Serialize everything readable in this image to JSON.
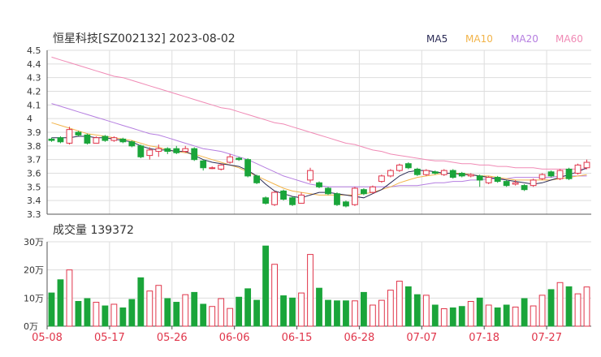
{
  "header": {
    "title": "恒星科技[SZ002132] 2023-08-02"
  },
  "legend": [
    {
      "label": "MA5",
      "color": "#2b2b55"
    },
    {
      "label": "MA10",
      "color": "#f2b44a"
    },
    {
      "label": "MA20",
      "color": "#b57ee0"
    },
    {
      "label": "MA60",
      "color": "#f08ab5"
    }
  ],
  "colors": {
    "up": "#e0354a",
    "down": "#1aa53a",
    "grid": "#dddddd",
    "axis": "#555555",
    "text": "#333333"
  },
  "chart_data": [
    {
      "type": "candlestick",
      "title": "恒星科技[SZ002132] 2023-08-02",
      "ylim": [
        3.3,
        4.5
      ],
      "yticks": [
        "4.5",
        "4.4",
        "4.3",
        "4.2",
        "4.1",
        "4",
        "3.9",
        "3.8",
        "3.7",
        "3.6",
        "3.5",
        "3.4",
        "3.3"
      ],
      "xticks": [
        {
          "label": "05-08",
          "index": 0
        },
        {
          "label": "05-17",
          "index": 7
        },
        {
          "label": "05-26",
          "index": 14
        },
        {
          "label": "06-06",
          "index": 21
        },
        {
          "label": "06-15",
          "index": 28
        },
        {
          "label": "06-28",
          "index": 35
        },
        {
          "label": "07-07",
          "index": 42
        },
        {
          "label": "07-18",
          "index": 49
        },
        {
          "label": "07-27",
          "index": 56
        }
      ],
      "candles": [
        [
          3.85,
          3.84,
          3.86,
          3.83
        ],
        [
          3.86,
          3.83,
          3.87,
          3.82
        ],
        [
          3.82,
          3.92,
          3.94,
          3.81
        ],
        [
          3.9,
          3.88,
          3.91,
          3.87
        ],
        [
          3.88,
          3.82,
          3.89,
          3.81
        ],
        [
          3.82,
          3.86,
          3.87,
          3.82
        ],
        [
          3.87,
          3.84,
          3.88,
          3.83
        ],
        [
          3.84,
          3.86,
          3.87,
          3.83
        ],
        [
          3.85,
          3.83,
          3.86,
          3.82
        ],
        [
          3.83,
          3.8,
          3.84,
          3.79
        ],
        [
          3.8,
          3.72,
          3.81,
          3.71
        ],
        [
          3.73,
          3.77,
          3.79,
          3.7
        ],
        [
          3.76,
          3.78,
          3.81,
          3.72
        ],
        [
          3.78,
          3.76,
          3.79,
          3.74
        ],
        [
          3.78,
          3.75,
          3.8,
          3.74
        ],
        [
          3.76,
          3.78,
          3.8,
          3.75
        ],
        [
          3.78,
          3.7,
          3.79,
          3.69
        ],
        [
          3.69,
          3.64,
          3.7,
          3.62
        ],
        [
          3.64,
          3.64,
          3.65,
          3.63
        ],
        [
          3.63,
          3.66,
          3.67,
          3.62
        ],
        [
          3.68,
          3.72,
          3.74,
          3.67
        ],
        [
          3.71,
          3.7,
          3.72,
          3.69
        ],
        [
          3.7,
          3.58,
          3.71,
          3.57
        ],
        [
          3.58,
          3.53,
          3.59,
          3.52
        ],
        [
          3.42,
          3.38,
          3.43,
          3.37
        ],
        [
          3.37,
          3.46,
          3.47,
          3.36
        ],
        [
          3.47,
          3.41,
          3.48,
          3.4
        ],
        [
          3.42,
          3.37,
          3.43,
          3.36
        ],
        [
          3.38,
          3.44,
          3.46,
          3.38
        ],
        [
          3.55,
          3.62,
          3.64,
          3.53
        ],
        [
          3.53,
          3.5,
          3.54,
          3.49
        ],
        [
          3.49,
          3.45,
          3.5,
          3.44
        ],
        [
          3.45,
          3.37,
          3.46,
          3.36
        ],
        [
          3.39,
          3.36,
          3.4,
          3.35
        ],
        [
          3.37,
          3.49,
          3.5,
          3.36
        ],
        [
          3.48,
          3.45,
          3.49,
          3.44
        ],
        [
          3.46,
          3.5,
          3.51,
          3.45
        ],
        [
          3.54,
          3.58,
          3.59,
          3.53
        ],
        [
          3.58,
          3.62,
          3.63,
          3.57
        ],
        [
          3.62,
          3.66,
          3.67,
          3.61
        ],
        [
          3.67,
          3.64,
          3.68,
          3.63
        ],
        [
          3.63,
          3.59,
          3.64,
          3.58
        ],
        [
          3.59,
          3.62,
          3.63,
          3.58
        ],
        [
          3.61,
          3.6,
          3.62,
          3.59
        ],
        [
          3.59,
          3.62,
          3.63,
          3.58
        ],
        [
          3.62,
          3.57,
          3.63,
          3.56
        ],
        [
          3.6,
          3.58,
          3.61,
          3.57
        ],
        [
          3.58,
          3.59,
          3.6,
          3.57
        ],
        [
          3.58,
          3.55,
          3.59,
          3.5
        ],
        [
          3.53,
          3.57,
          3.58,
          3.52
        ],
        [
          3.57,
          3.54,
          3.58,
          3.53
        ],
        [
          3.54,
          3.51,
          3.55,
          3.5
        ],
        [
          3.52,
          3.53,
          3.55,
          3.51
        ],
        [
          3.51,
          3.48,
          3.52,
          3.47
        ],
        [
          3.51,
          3.55,
          3.56,
          3.5
        ],
        [
          3.56,
          3.59,
          3.6,
          3.55
        ],
        [
          3.61,
          3.58,
          3.62,
          3.57
        ],
        [
          3.56,
          3.62,
          3.63,
          3.55
        ],
        [
          3.63,
          3.56,
          3.64,
          3.55
        ],
        [
          3.6,
          3.66,
          3.67,
          3.59
        ],
        [
          3.64,
          3.68,
          3.7,
          3.63
        ]
      ],
      "ma5": [
        3.86,
        3.86,
        3.86,
        3.87,
        3.87,
        3.86,
        3.86,
        3.85,
        3.84,
        3.83,
        3.8,
        3.78,
        3.77,
        3.77,
        3.76,
        3.76,
        3.73,
        3.7,
        3.68,
        3.67,
        3.66,
        3.65,
        3.62,
        3.58,
        3.52,
        3.47,
        3.45,
        3.43,
        3.42,
        3.44,
        3.46,
        3.46,
        3.45,
        3.44,
        3.43,
        3.42,
        3.45,
        3.48,
        3.53,
        3.58,
        3.61,
        3.62,
        3.62,
        3.61,
        3.6,
        3.6,
        3.59,
        3.59,
        3.58,
        3.57,
        3.56,
        3.55,
        3.54,
        3.53,
        3.52,
        3.53,
        3.55,
        3.57,
        3.59,
        3.61,
        3.64
      ],
      "ma10": [
        3.97,
        3.95,
        3.93,
        3.91,
        3.89,
        3.88,
        3.87,
        3.86,
        3.85,
        3.84,
        3.82,
        3.8,
        3.79,
        3.77,
        3.76,
        3.75,
        3.74,
        3.72,
        3.7,
        3.68,
        3.66,
        3.64,
        3.61,
        3.58,
        3.55,
        3.52,
        3.49,
        3.47,
        3.46,
        3.45,
        3.44,
        3.44,
        3.44,
        3.44,
        3.44,
        3.45,
        3.46,
        3.48,
        3.5,
        3.53,
        3.55,
        3.57,
        3.58,
        3.59,
        3.6,
        3.6,
        3.6,
        3.59,
        3.58,
        3.58,
        3.57,
        3.56,
        3.55,
        3.55,
        3.55,
        3.55,
        3.55,
        3.56,
        3.57,
        3.58,
        3.59
      ],
      "ma20": [
        4.11,
        4.09,
        4.07,
        4.05,
        4.03,
        4.01,
        3.99,
        3.97,
        3.95,
        3.93,
        3.91,
        3.89,
        3.88,
        3.86,
        3.84,
        3.82,
        3.8,
        3.78,
        3.77,
        3.76,
        3.74,
        3.72,
        3.7,
        3.67,
        3.64,
        3.61,
        3.58,
        3.56,
        3.54,
        3.52,
        3.51,
        3.5,
        3.5,
        3.5,
        3.5,
        3.5,
        3.5,
        3.5,
        3.5,
        3.51,
        3.51,
        3.51,
        3.52,
        3.53,
        3.53,
        3.54,
        3.54,
        3.55,
        3.55,
        3.56,
        3.56,
        3.56,
        3.57,
        3.57,
        3.57,
        3.57,
        3.57,
        3.58,
        3.58,
        3.58,
        3.58
      ],
      "ma60": [
        4.45,
        4.43,
        4.41,
        4.39,
        4.37,
        4.35,
        4.33,
        4.31,
        4.3,
        4.28,
        4.26,
        4.24,
        4.22,
        4.2,
        4.18,
        4.16,
        4.14,
        4.12,
        4.1,
        4.08,
        4.07,
        4.05,
        4.03,
        4.01,
        3.99,
        3.97,
        3.96,
        3.94,
        3.92,
        3.9,
        3.88,
        3.86,
        3.84,
        3.82,
        3.81,
        3.79,
        3.77,
        3.76,
        3.74,
        3.73,
        3.72,
        3.71,
        3.7,
        3.69,
        3.69,
        3.68,
        3.67,
        3.67,
        3.66,
        3.66,
        3.65,
        3.65,
        3.64,
        3.64,
        3.64,
        3.63,
        3.63,
        3.63,
        3.63,
        3.63,
        3.63
      ]
    },
    {
      "type": "bar",
      "title": "成交量 139372",
      "ylim": [
        0,
        300000
      ],
      "yticks": [
        "30万",
        "20万",
        "10万",
        "0万"
      ],
      "xticks": [
        "05-08",
        "05-17",
        "05-26",
        "06-06",
        "06-15",
        "06-28",
        "07-07",
        "07-18",
        "07-27"
      ],
      "values": [
        118000,
        165000,
        200000,
        88000,
        98000,
        85000,
        72000,
        78000,
        65000,
        95000,
        172000,
        125000,
        145000,
        98000,
        85000,
        112000,
        120000,
        78000,
        70000,
        98000,
        63000,
        103000,
        133000,
        92000,
        285000,
        220000,
        108000,
        100000,
        118000,
        255000,
        135000,
        92000,
        90000,
        90000,
        90000,
        120000,
        75000,
        92000,
        128000,
        160000,
        140000,
        112000,
        110000,
        75000,
        62000,
        65000,
        70000,
        88000,
        100000,
        75000,
        65000,
        75000,
        68000,
        98000,
        72000,
        110000,
        130000,
        155000,
        140000,
        115000,
        139372
      ]
    }
  ]
}
